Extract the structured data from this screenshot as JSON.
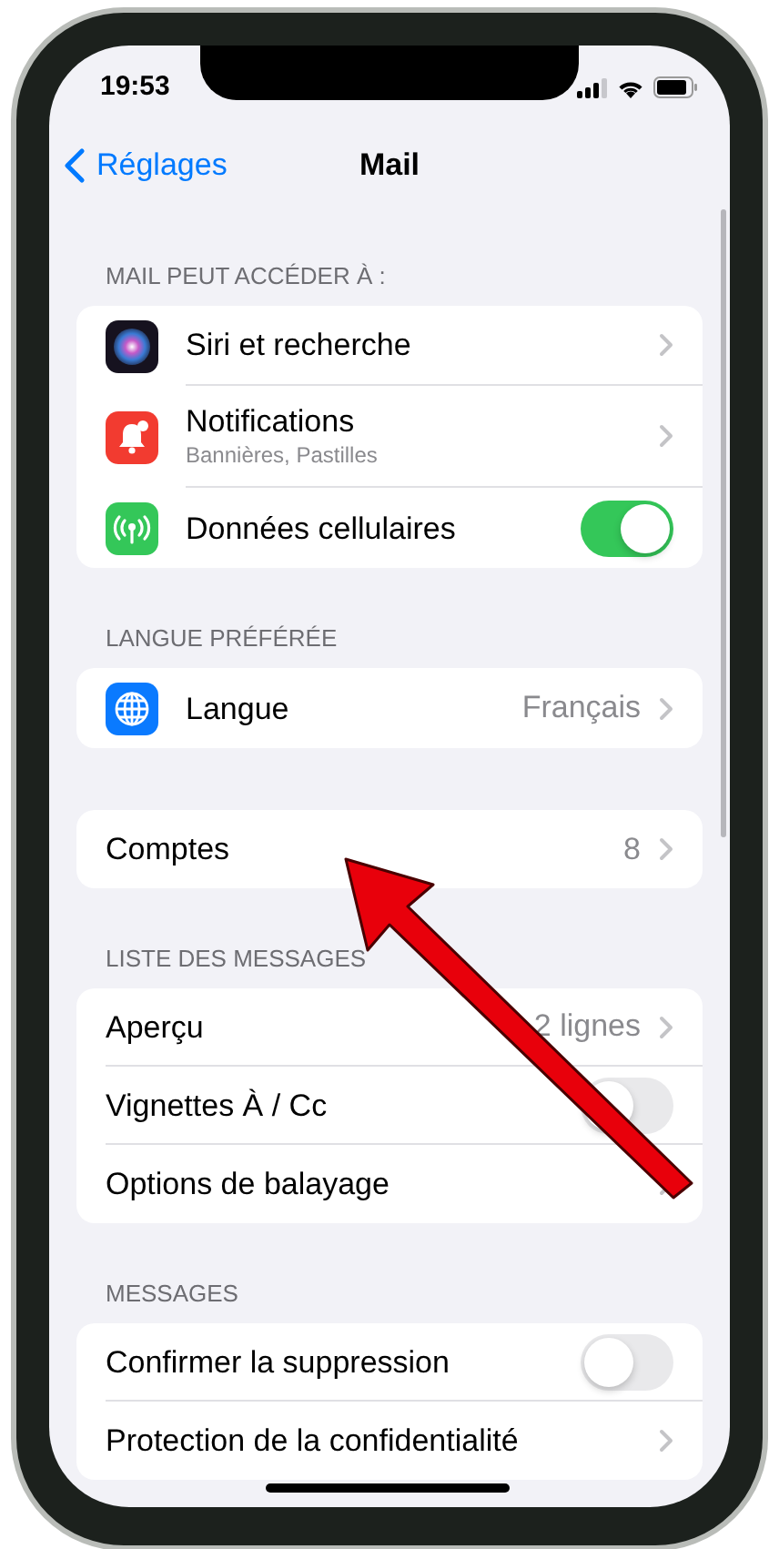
{
  "status_bar": {
    "time": "19:53"
  },
  "nav": {
    "back": "Réglages",
    "title": "Mail"
  },
  "sections": [
    {
      "header": "MAIL PEUT ACCÉDER À :",
      "rows": [
        {
          "kind": "link",
          "label": "Siri et recherche"
        },
        {
          "kind": "link",
          "label": "Notifications",
          "subtitle": "Bannières, Pastilles"
        },
        {
          "kind": "toggle",
          "label": "Données cellulaires",
          "on": true
        }
      ]
    },
    {
      "header": "LANGUE PRÉFÉRÉE",
      "rows": [
        {
          "kind": "link",
          "label": "Langue",
          "value": "Français"
        }
      ]
    },
    {
      "rows": [
        {
          "kind": "link",
          "label": "Comptes",
          "value": "8"
        }
      ]
    },
    {
      "header": "LISTE DES MESSAGES",
      "rows": [
        {
          "kind": "link",
          "label": "Aperçu",
          "value": "2 lignes"
        },
        {
          "kind": "toggle",
          "label": "Vignettes À / Cc",
          "on": false
        },
        {
          "kind": "link",
          "label": "Options de balayage"
        }
      ]
    },
    {
      "header": "MESSAGES",
      "rows": [
        {
          "kind": "toggle",
          "label": "Confirmer la suppression",
          "on": false
        },
        {
          "kind": "link",
          "label": "Protection de la confidentialité"
        }
      ]
    }
  ]
}
